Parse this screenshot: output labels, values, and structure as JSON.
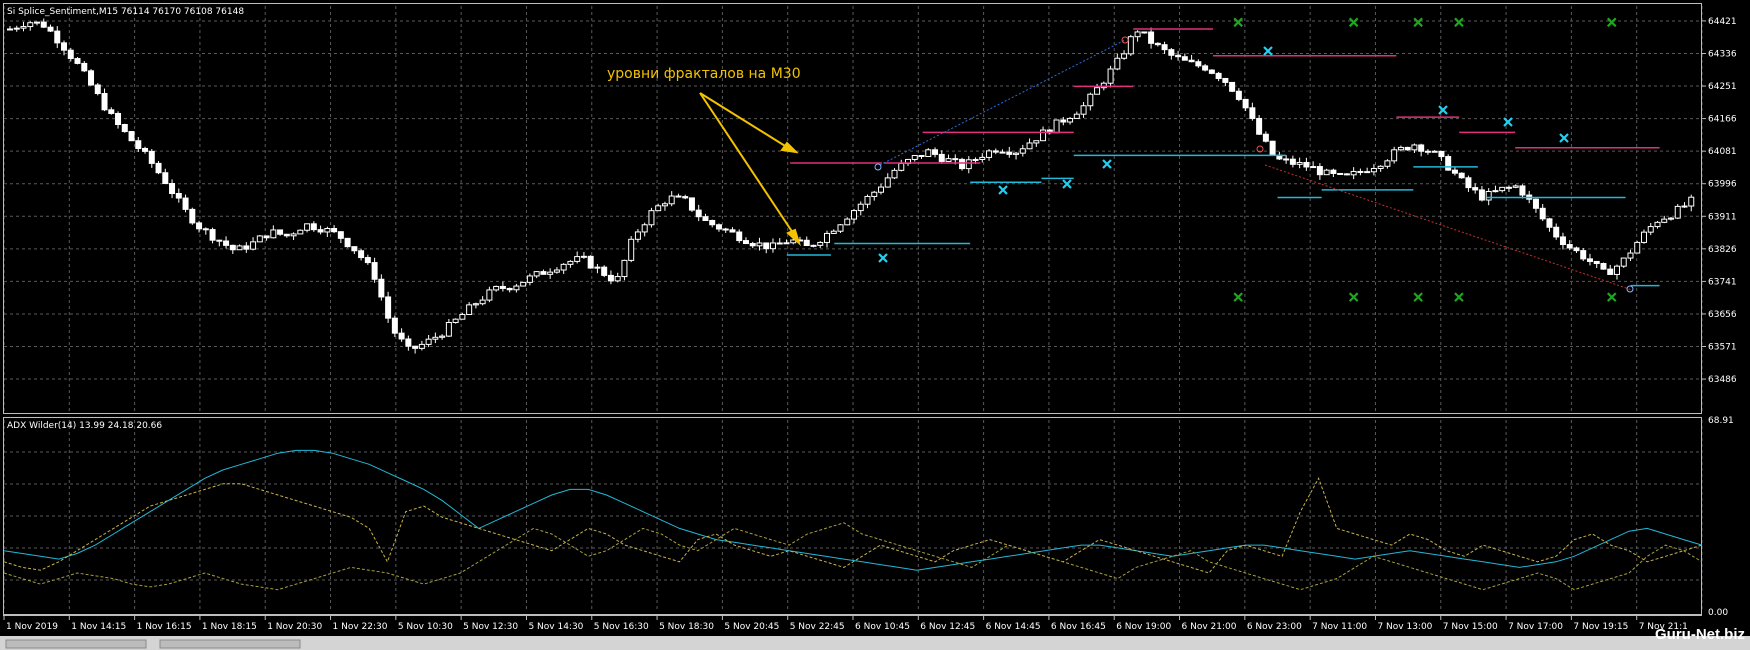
{
  "window": {
    "title": "Si Splice_Sentiment,M15  76114 76170 76108 76148",
    "adx_title": "ADX Wilder(14) 13.99 24.18 20.66",
    "watermark": "Guru-Net.biz",
    "annotation": "уровни фракталов на М30"
  },
  "colors": {
    "background": "#000000",
    "grid": "#5a5a5a",
    "candle_up": "#ffffff",
    "candle_down": "#ffffff",
    "resistance_level": "#e0307e",
    "support_level": "#22b8d8",
    "fractal_up_marker": "#1fa61f",
    "fractal_down_marker": "#22d0f0",
    "annotation": "#f2c200",
    "adx_main": "#22b8d8",
    "adx_plus_di": "#c8b24a",
    "adx_minus_di": "#a6a03a"
  },
  "chart_data": [
    {
      "type": "candlestick",
      "title": "Si Splice_Sentiment,M15  76114 76170 76108 76148",
      "y_ticks": [
        "64421",
        "64336",
        "64251",
        "64166",
        "64081",
        "63996",
        "63911",
        "63826",
        "63741",
        "63656",
        "63571",
        "63486"
      ],
      "ylim": [
        63400,
        64460
      ],
      "x_labels": [
        "1 Nov 2019",
        "1 Nov 14:15",
        "1 Nov 16:15",
        "1 Nov 18:15",
        "1 Nov 20:30",
        "1 Nov 22:30",
        "5 Nov 10:30",
        "5 Nov 12:30",
        "5 Nov 14:30",
        "5 Nov 16:30",
        "5 Nov 18:30",
        "5 Nov 20:45",
        "5 Nov 22:45",
        "6 Nov 10:45",
        "6 Nov 12:45",
        "6 Nov 14:45",
        "6 Nov 16:45",
        "6 Nov 19:00",
        "6 Nov 21:00",
        "6 Nov 23:00",
        "7 Nov 11:00",
        "7 Nov 13:00",
        "7 Nov 15:00",
        "7 Nov 17:00",
        "7 Nov 19:15",
        "7 Nov 21:1"
      ],
      "close_path": [
        64400,
        64420,
        64410,
        64360,
        64300,
        64230,
        64160,
        64110,
        64060,
        64000,
        63930,
        63880,
        63850,
        63820,
        63840,
        63870,
        63860,
        63890,
        63880,
        63860,
        63820,
        63760,
        63620,
        63560,
        63580,
        63610,
        63650,
        63690,
        63720,
        63730,
        63750,
        63770,
        63790,
        63800,
        63770,
        63740,
        63860,
        63920,
        63960,
        63950,
        63900,
        63880,
        63860,
        63840,
        63830,
        63850,
        63830,
        63860,
        63900,
        63940,
        63980,
        64030,
        64060,
        64080,
        64060,
        64040,
        64070,
        64090,
        64080,
        64110,
        64140,
        64170,
        64200,
        64260,
        64320,
        64400,
        64360,
        64330,
        64310,
        64300,
        64270,
        64220,
        64130,
        64060,
        64050,
        64040,
        64020,
        64010,
        64030,
        64050,
        64080,
        64100,
        64080,
        64040,
        63990,
        63960,
        63980,
        63990,
        63930,
        63870,
        63830,
        63800,
        63760,
        63790,
        63850,
        63900,
        63920,
        63950
      ],
      "resistance_levels": [
        {
          "start": 0.463,
          "end": 0.517,
          "value": 64050
        },
        {
          "start": 0.518,
          "end": 0.575,
          "value": 64050
        },
        {
          "start": 0.541,
          "end": 0.63,
          "value": 64130
        },
        {
          "start": 0.63,
          "end": 0.665,
          "value": 64250
        },
        {
          "start": 0.665,
          "end": 0.712,
          "value": 64400
        },
        {
          "start": 0.712,
          "end": 0.82,
          "value": 64330
        },
        {
          "start": 0.82,
          "end": 0.857,
          "value": 64170
        },
        {
          "start": 0.857,
          "end": 0.89,
          "value": 64130
        },
        {
          "start": 0.89,
          "end": 0.975,
          "value": 64090
        }
      ],
      "support_levels": [
        {
          "start": 0.461,
          "end": 0.487,
          "value": 63810
        },
        {
          "start": 0.489,
          "end": 0.569,
          "value": 63840
        },
        {
          "start": 0.569,
          "end": 0.611,
          "value": 64000
        },
        {
          "start": 0.611,
          "end": 0.63,
          "value": 64010
        },
        {
          "start": 0.63,
          "end": 0.715,
          "value": 64070
        },
        {
          "start": 0.715,
          "end": 0.755,
          "value": 64070
        },
        {
          "start": 0.75,
          "end": 0.776,
          "value": 63960
        },
        {
          "start": 0.776,
          "end": 0.83,
          "value": 63980
        },
        {
          "start": 0.83,
          "end": 0.868,
          "value": 64040
        },
        {
          "start": 0.873,
          "end": 0.955,
          "value": 63960
        },
        {
          "start": 0.958,
          "end": 0.975,
          "value": 63730
        }
      ],
      "up_fractals": [
        0.506,
        0.574,
        0.612,
        0.636,
        0.726,
        0.826,
        0.862,
        0.895
      ],
      "down_fractals": [
        0.506,
        0.574,
        0.612,
        0.636,
        0.726,
        0.826,
        0.862,
        0.895
      ],
      "fractal_rows": {
        "up": 64420,
        "down": 63700
      }
    },
    {
      "type": "line",
      "title": "ADX Wilder(14) 13.99 24.18 20.66",
      "y_ticks": [
        "68.91",
        "0.00"
      ],
      "ylim": [
        0,
        68.91
      ],
      "series": [
        {
          "values": [
            22,
            21,
            20,
            19,
            21,
            24,
            28,
            32,
            36,
            40,
            44,
            48,
            51,
            53,
            55,
            57,
            58,
            58,
            57,
            55,
            53,
            50,
            47,
            44,
            40,
            35,
            30,
            33,
            36,
            39,
            42,
            44,
            44,
            42,
            39,
            36,
            33,
            30,
            28,
            26,
            25,
            24,
            23,
            22,
            21,
            20,
            19,
            18,
            17,
            16,
            15,
            16,
            17,
            18,
            19,
            20,
            21,
            22,
            23,
            24,
            24,
            23,
            22,
            21,
            20,
            21,
            22,
            23,
            24,
            24,
            23,
            22,
            21,
            20,
            19,
            20,
            21,
            22,
            21,
            20,
            19,
            18,
            17,
            16,
            17,
            18,
            20,
            23,
            26,
            29,
            30,
            28,
            26,
            24
          ]
        },
        {
          "values": [
            18,
            16,
            15,
            18,
            22,
            26,
            30,
            34,
            38,
            40,
            42,
            44,
            46,
            46,
            44,
            42,
            40,
            38,
            36,
            34,
            30,
            18,
            36,
            38,
            34,
            32,
            30,
            28,
            26,
            24,
            22,
            26,
            30,
            28,
            24,
            22,
            20,
            18,
            26,
            28,
            24,
            22,
            20,
            22,
            20,
            18,
            16,
            20,
            24,
            22,
            20,
            18,
            22,
            24,
            26,
            24,
            22,
            20,
            18,
            22,
            26,
            24,
            22,
            20,
            18,
            16,
            14,
            22,
            24,
            22,
            20,
            36,
            48,
            30,
            28,
            26,
            24,
            28,
            26,
            22,
            20,
            24,
            22,
            20,
            18,
            20,
            26,
            28,
            24,
            22,
            18,
            20,
            22,
            24
          ]
        },
        {
          "values": [
            14,
            12,
            10,
            12,
            14,
            13,
            12,
            10,
            9,
            10,
            12,
            14,
            12,
            10,
            9,
            8,
            10,
            12,
            14,
            16,
            15,
            14,
            12,
            10,
            12,
            14,
            18,
            22,
            26,
            30,
            28,
            24,
            20,
            22,
            26,
            30,
            28,
            24,
            22,
            26,
            30,
            28,
            26,
            24,
            28,
            30,
            32,
            28,
            26,
            24,
            22,
            20,
            18,
            16,
            20,
            24,
            22,
            20,
            18,
            16,
            14,
            12,
            16,
            18,
            20,
            22,
            18,
            16,
            14,
            12,
            10,
            8,
            10,
            12,
            16,
            20,
            18,
            16,
            14,
            12,
            10,
            8,
            10,
            12,
            14,
            12,
            8,
            10,
            12,
            14,
            20,
            24,
            22,
            18
          ]
        }
      ]
    }
  ]
}
